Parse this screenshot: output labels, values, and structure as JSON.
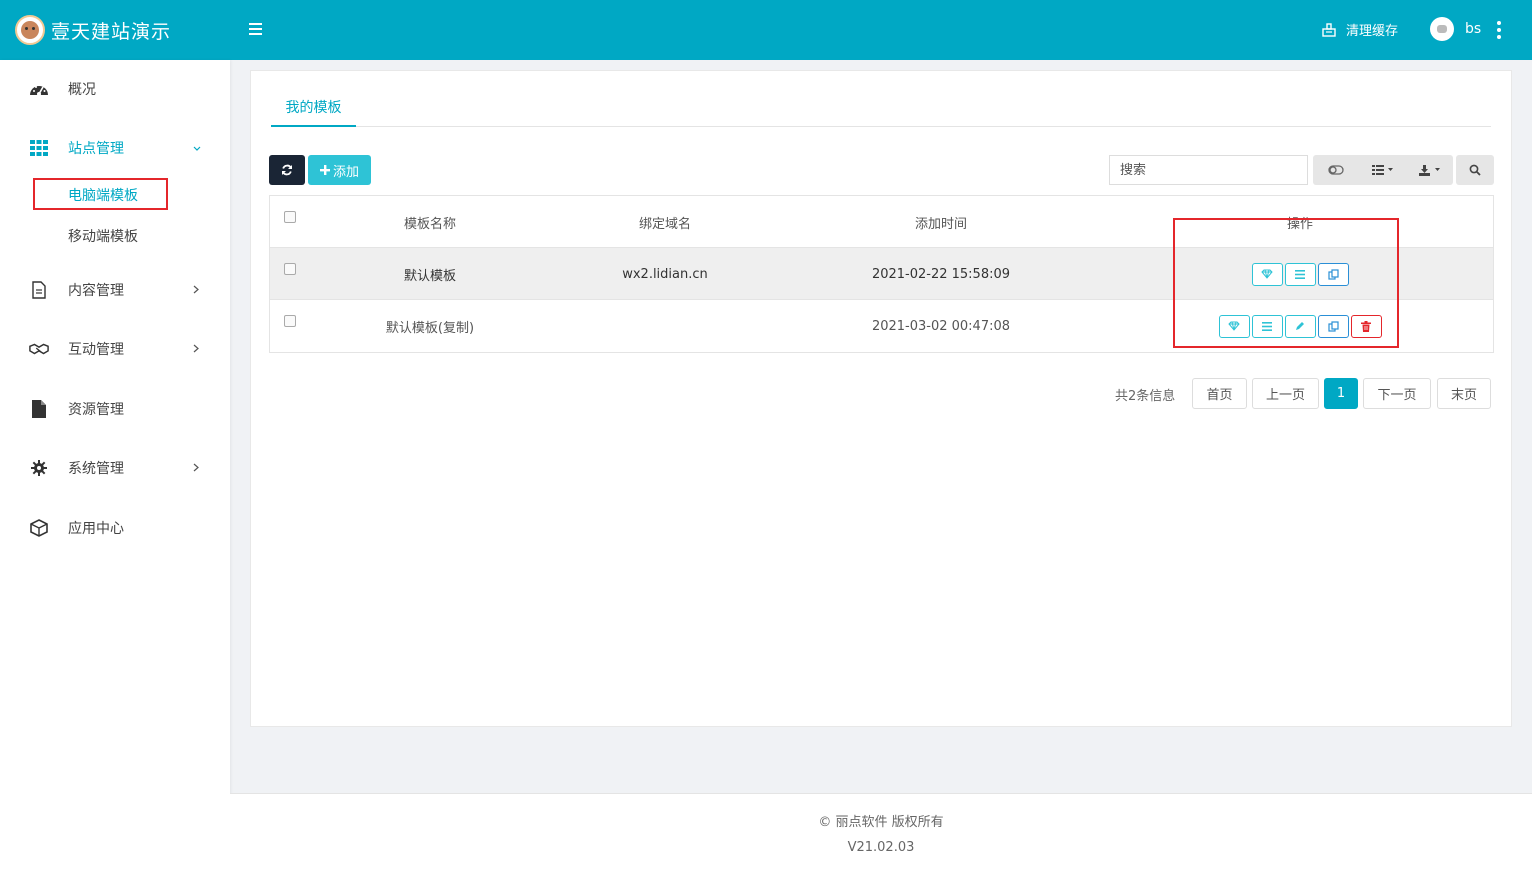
{
  "header": {
    "brand_title": "壹天建站演示",
    "clear_cache": "清理缓存",
    "username": "bs"
  },
  "sidebar": {
    "items": [
      {
        "label": "概况",
        "icon": "dashboard-icon"
      },
      {
        "label": "站点管理",
        "icon": "grid-icon",
        "expanded": true
      },
      {
        "label": "内容管理",
        "icon": "document-icon"
      },
      {
        "label": "互动管理",
        "icon": "handshake-icon"
      },
      {
        "label": "资源管理",
        "icon": "file-icon"
      },
      {
        "label": "系统管理",
        "icon": "gear-icon"
      },
      {
        "label": "应用中心",
        "icon": "cube-icon"
      }
    ],
    "sub_items": [
      {
        "label": "电脑端模板",
        "active": true
      },
      {
        "label": "移动端模板"
      }
    ]
  },
  "main": {
    "tab": "我的模板",
    "toolbar": {
      "add_label": "添加",
      "search_placeholder": "搜索"
    },
    "table": {
      "columns": [
        "模板名称",
        "绑定域名",
        "添加时间",
        "操作"
      ],
      "rows": [
        {
          "name": "默认模板",
          "domain": "wx2.lidian.cn",
          "time": "2021-02-22 15:58:09"
        },
        {
          "name": "默认模板(复制)",
          "domain": "",
          "time": "2021-03-02 00:47:08"
        }
      ]
    },
    "pagination": {
      "total": "共2条信息",
      "first": "首页",
      "prev": "上一页",
      "current": "1",
      "next": "下一页",
      "last": "末页"
    }
  },
  "footer": {
    "copyright": "© 丽点软件 版权所有",
    "version": "V21.02.03"
  },
  "colors": {
    "primary": "#00a8c4",
    "highlight_box": "#e4262b",
    "dark_button": "#1a2535"
  }
}
